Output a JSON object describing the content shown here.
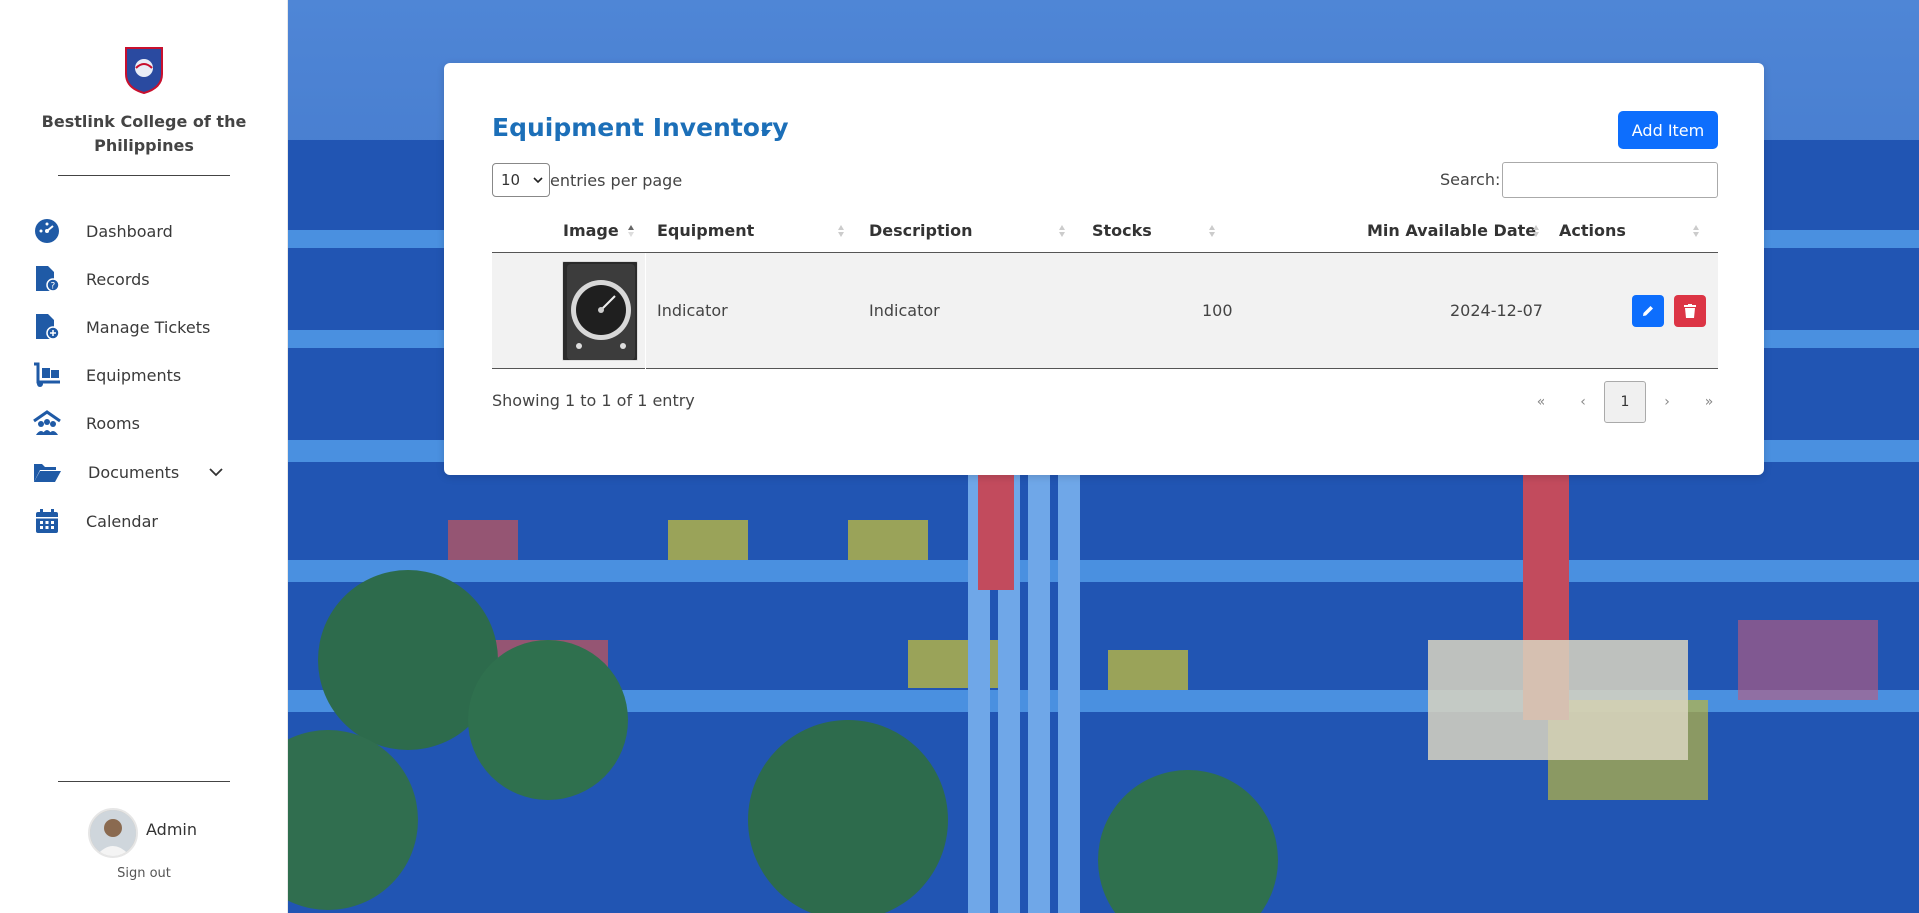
{
  "sidebar": {
    "college_name": "Bestlink College of the Philippines",
    "items": [
      {
        "label": "Dashboard"
      },
      {
        "label": "Records"
      },
      {
        "label": "Manage Tickets"
      },
      {
        "label": "Equipments"
      },
      {
        "label": "Rooms"
      },
      {
        "label": "Documents"
      },
      {
        "label": "Calendar"
      }
    ],
    "user_name": "Admin",
    "signout_label": "Sign out"
  },
  "card": {
    "title": "Equipment Inventory",
    "add_label": "Add Item",
    "entries_value": "10",
    "entries_label": "entries per page",
    "search_label": "Search:",
    "search_value": ""
  },
  "table": {
    "headers": [
      "Image",
      "Equipment",
      "Description",
      "Stocks",
      "Min Available Date",
      "Actions"
    ],
    "rows": [
      {
        "equipment": "Indicator",
        "description": "Indicator",
        "stocks": "100",
        "min_date": "2024-12-07"
      }
    ]
  },
  "footer": {
    "info": "Showing 1 to 1 of 1 entry",
    "pages": [
      "«",
      "‹",
      "1",
      "›",
      "»"
    ]
  },
  "colors": {
    "accent": "#0d6efd",
    "title": "#1c6fb8",
    "danger": "#dc3545",
    "nav_icon": "#1f5aa6"
  }
}
